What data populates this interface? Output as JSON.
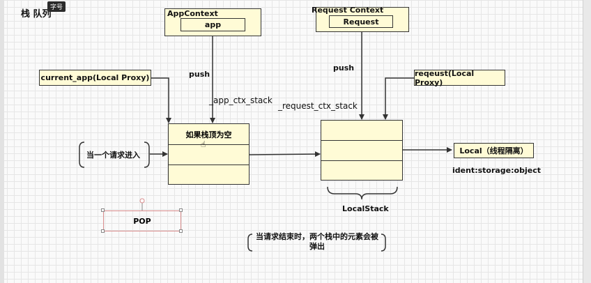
{
  "title": "栈 队列",
  "badge": "字号",
  "app_context": {
    "label": "AppContext",
    "inner": "app"
  },
  "request_context": {
    "label": "Request Context",
    "inner": "Request"
  },
  "current_app": "current_app(Local Proxy)",
  "request_proxy": "reqeust(Local Proxy)",
  "push_left": "push",
  "push_right": "push",
  "app_ctx_stack": "_app_ctx_stack",
  "request_ctx_stack": "_request_ctx_stack",
  "left_stack_top": "如果栈顶为空",
  "request_enter": "当一个请求进入",
  "local": "Local（线程隔离）",
  "ident": "ident:storage:object",
  "local_stack": "LocalStack",
  "pop": "POP",
  "note_line1": "当请求结束时，两个栈中的元素会被",
  "note_line2": "弹出",
  "colors": {
    "box_fill": "#fffbd6",
    "stroke": "#333333",
    "pop_border": "#d98c8c"
  }
}
